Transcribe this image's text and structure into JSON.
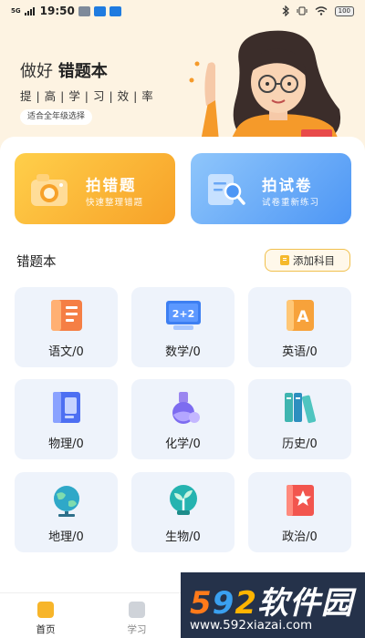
{
  "status_bar": {
    "network": "5G",
    "time": "19:50",
    "battery": "100"
  },
  "header": {
    "title_prefix": "做好",
    "title_bold": "错题本",
    "slogan": "提 | 高 | 学 | 习 | 效 | 率",
    "grade_tag": "适合全年级选择"
  },
  "actions": {
    "photo": {
      "title": "拍错题",
      "subtitle": "快速整理错题",
      "icon": "camera-icon"
    },
    "paper": {
      "title": "拍试卷",
      "subtitle": "试卷重新练习",
      "icon": "document-search-icon"
    }
  },
  "notebook": {
    "title": "错题本",
    "add_label": "添加科目"
  },
  "subjects": [
    {
      "label": "语文/0",
      "icon": "book-icon"
    },
    {
      "label": "数学/0",
      "icon": "math-board-icon"
    },
    {
      "label": "英语/0",
      "icon": "letter-a-icon"
    },
    {
      "label": "物理/0",
      "icon": "notebook-icon"
    },
    {
      "label": "化学/0",
      "icon": "flask-icon"
    },
    {
      "label": "历史/0",
      "icon": "books-icon"
    },
    {
      "label": "地理/0",
      "icon": "globe-icon"
    },
    {
      "label": "生物/0",
      "icon": "sprout-icon"
    },
    {
      "label": "政治/0",
      "icon": "star-book-icon"
    }
  ],
  "tabbar": {
    "home": "首页",
    "study": "学习"
  },
  "watermark": {
    "digits": [
      "5",
      "9",
      "2"
    ],
    "name": "软件园",
    "url": "www.592xiazai.com"
  },
  "colors": {
    "background": "#fdf3e2",
    "photo_card": "#f7a128",
    "paper_card": "#4d96f5",
    "accent": "#f7b52a"
  }
}
